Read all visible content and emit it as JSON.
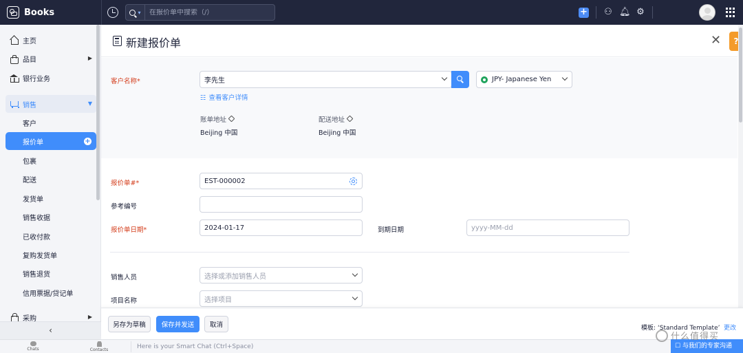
{
  "app": {
    "name": "Books"
  },
  "search": {
    "placeholder": "在报价单中搜索（/）"
  },
  "sidebar": {
    "items": [
      {
        "label": "主页"
      },
      {
        "label": "品目"
      },
      {
        "label": "银行业务"
      },
      {
        "label": "销售"
      },
      {
        "label": "采购"
      }
    ],
    "sales_children": [
      {
        "label": "客户"
      },
      {
        "label": "报价单"
      },
      {
        "label": "包裹"
      },
      {
        "label": "配送"
      },
      {
        "label": "发货单"
      },
      {
        "label": "销售收据"
      },
      {
        "label": "已收付款"
      },
      {
        "label": "复购发货单"
      },
      {
        "label": "销售退货"
      },
      {
        "label": "信用票据/贷记单"
      }
    ],
    "collapse_glyph": "‹"
  },
  "page": {
    "title": "新建报价单"
  },
  "form": {
    "customer_label": "客户名称*",
    "customer_value": "李先生",
    "currency_value": "JPY- Japanese Yen",
    "view_customer_link": "查看客户详情",
    "billing_label": "账单地址",
    "billing_value": "Beijing 中国",
    "shipping_label": "配送地址",
    "shipping_value": "Beijing 中国",
    "quote_no_label": "报价单#*",
    "quote_no_value": "EST-000002",
    "reference_label": "参考编号",
    "reference_value": "",
    "quote_date_label": "报价单日期*",
    "quote_date_value": "2024-01-17",
    "expiry_label": "到期日期",
    "expiry_placeholder": "yyyy-MM-dd",
    "salesperson_label": "销售人员",
    "salesperson_placeholder": "选择或添加销售人员",
    "project_label": "项目名称",
    "project_placeholder": "选择项目"
  },
  "footer": {
    "save_draft": "另存为草稿",
    "save_send": "保存并发送",
    "cancel": "取消",
    "template_text": "模板: ‘Standard Template’",
    "template_change": "更改"
  },
  "chatbar": {
    "chats": "Chats",
    "contacts": "Contacts",
    "placeholder": "Here is your Smart Chat (Ctrl+Space)",
    "blue_text": "与我们的专家沟通"
  },
  "watermark": {
    "text": "什么值得买"
  },
  "colors": {
    "accent": "#408dfb",
    "topbar": "#21263c",
    "required": "#d4401f",
    "help": "#f49b2a"
  }
}
